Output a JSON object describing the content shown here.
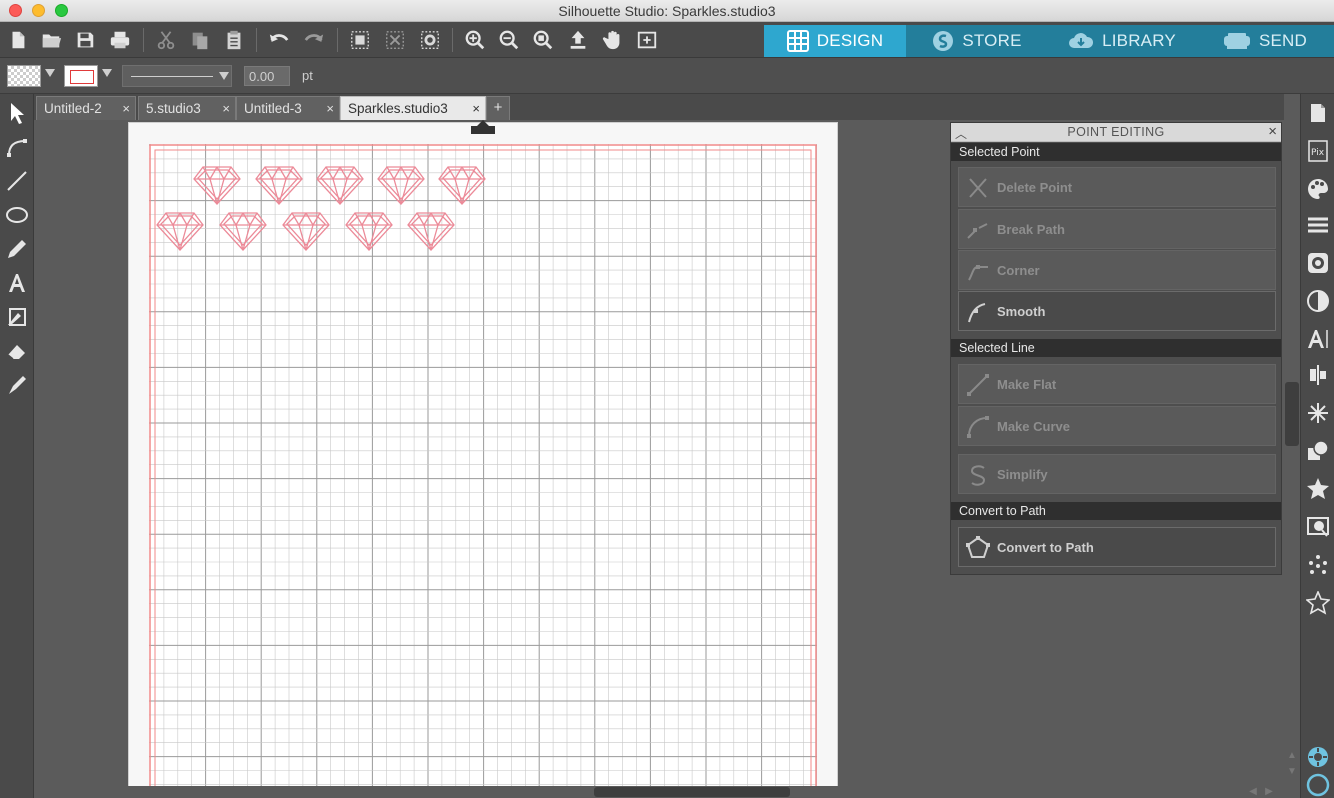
{
  "window": {
    "title": "Silhouette Studio: Sparkles.studio3"
  },
  "nav": {
    "design": "DESIGN",
    "store": "STORE",
    "library": "LIBRARY",
    "send": "SEND"
  },
  "line_settings": {
    "weight_value": "0.00",
    "unit": "pt"
  },
  "doc_tabs": [
    "Untitled-2",
    "5.studio3",
    "Untitled-3",
    "Sparkles.studio3"
  ],
  "active_tab": "Sparkles.studio3",
  "add_tab_label": "+",
  "close_glyph": "×",
  "point_editing": {
    "title": "POINT EDITING",
    "sections": {
      "selected_point": "Selected Point",
      "selected_line": "Selected Line",
      "convert_to_path": "Convert to Path"
    },
    "buttons": {
      "delete_point": "Delete Point",
      "break_path": "Break Path",
      "corner": "Corner",
      "smooth": "Smooth",
      "make_flat": "Make Flat",
      "make_curve": "Make Curve",
      "simplify": "Simplify",
      "convert_to_path": "Convert to Path"
    }
  },
  "design": {
    "shape": "diamond",
    "rows": [
      5,
      5
    ],
    "stroke_color": "#ec8a98"
  },
  "colors": {
    "design_tab": "#2ea7cf",
    "nav_tab": "#237e9b",
    "mat_red": "#f08a8a",
    "grid": "#c8c8c8",
    "grid_major": "#9a9a9a"
  }
}
